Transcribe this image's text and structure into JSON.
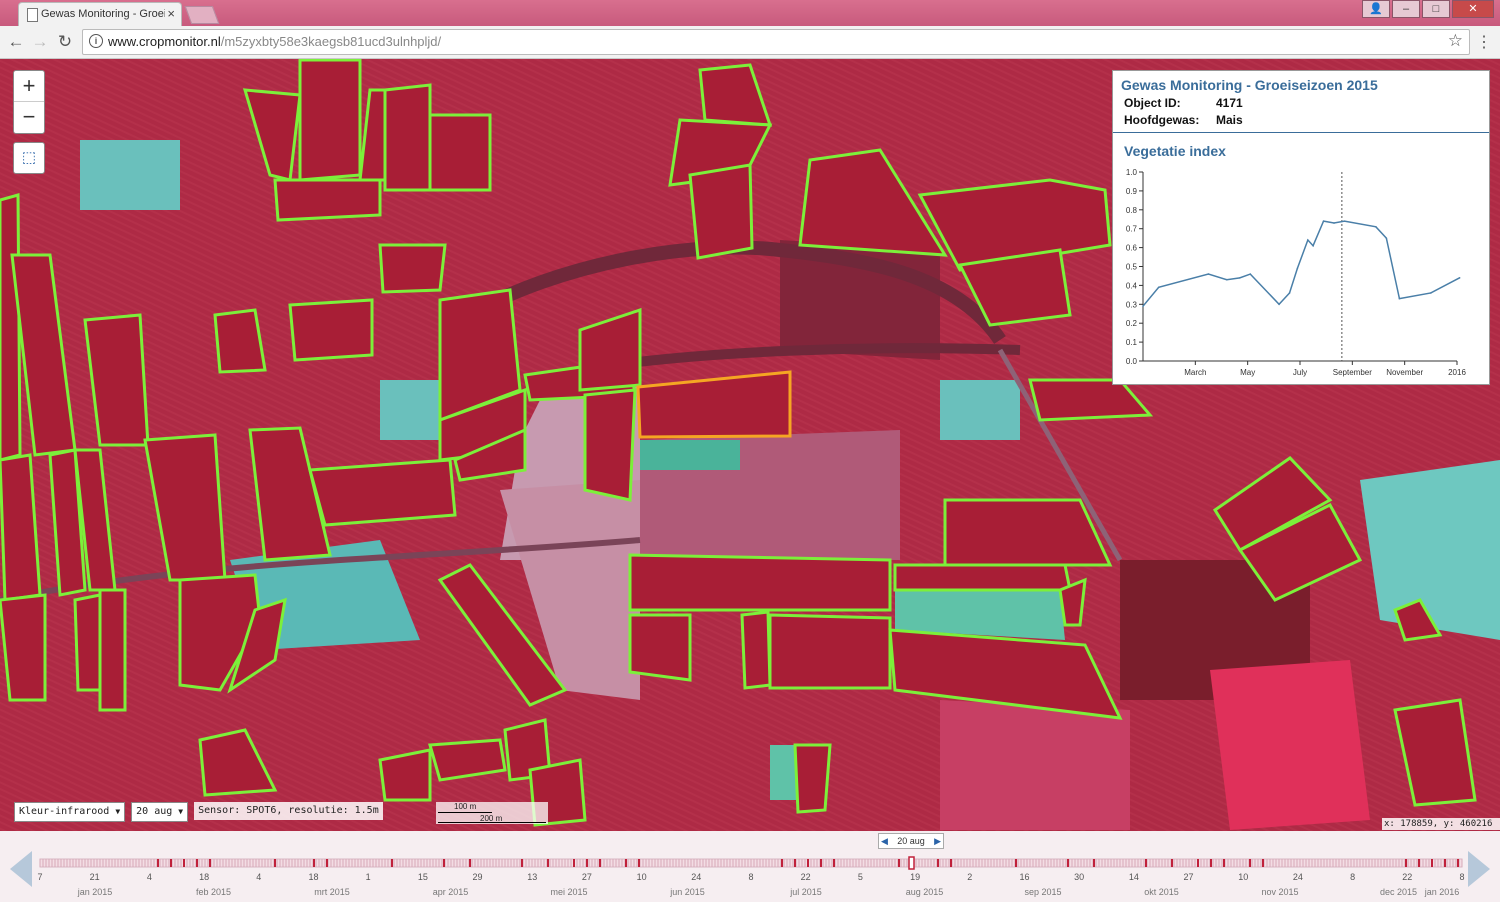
{
  "browser": {
    "tab_title": "Gewas Monitoring - Groeiseizoen 2015",
    "url_host": "www.cropmonitor.nl",
    "url_path": "/m5zyxbty58e3kaegsb81ucd3ulnhpljd/"
  },
  "map": {
    "zoom_in": "+",
    "zoom_out": "−",
    "layer_select": "Kleur-infrarood",
    "date_select": "20 aug",
    "sensor_text": "Sensor: SPOT6, resolutie: 1.5m",
    "scale_100": "100 m",
    "scale_200": "200 m",
    "coord_readout": "x: 178859, y: 460216"
  },
  "panel": {
    "title": "Gewas Monitoring - Groeiseizoen 2015",
    "object_id_label": "Object ID:",
    "object_id_value": "4171",
    "crop_label": "Hoofdgewas:",
    "crop_value": "Mais",
    "chart_title": "Vegetatie index"
  },
  "chart_data": {
    "type": "line",
    "title": "Vegetatie index",
    "xlabel": "",
    "ylabel": "",
    "ylim": [
      0,
      1.0
    ],
    "yticks": [
      "0.0",
      "0.1",
      "0.2",
      "0.3",
      "0.4",
      "0.5",
      "0.6",
      "0.7",
      "0.8",
      "0.9",
      "1.0"
    ],
    "xticks": [
      "March",
      "May",
      "July",
      "September",
      "November",
      "2016"
    ],
    "xtick_months": [
      2,
      4,
      6,
      8,
      10,
      12
    ],
    "xrange_months": [
      0,
      12
    ],
    "current_marker_month": 7.6,
    "series": [
      {
        "values": [
          {
            "x": 0.0,
            "y": 0.29
          },
          {
            "x": 0.6,
            "y": 0.39
          },
          {
            "x": 2.5,
            "y": 0.46
          },
          {
            "x": 3.2,
            "y": 0.43
          },
          {
            "x": 3.7,
            "y": 0.44
          },
          {
            "x": 4.1,
            "y": 0.46
          },
          {
            "x": 5.2,
            "y": 0.3
          },
          {
            "x": 5.6,
            "y": 0.36
          },
          {
            "x": 5.9,
            "y": 0.49
          },
          {
            "x": 6.3,
            "y": 0.64
          },
          {
            "x": 6.5,
            "y": 0.61
          },
          {
            "x": 6.9,
            "y": 0.74
          },
          {
            "x": 7.3,
            "y": 0.73
          },
          {
            "x": 7.7,
            "y": 0.74
          },
          {
            "x": 8.9,
            "y": 0.71
          },
          {
            "x": 9.3,
            "y": 0.65
          },
          {
            "x": 9.8,
            "y": 0.33
          },
          {
            "x": 11.0,
            "y": 0.36
          },
          {
            "x": 12.1,
            "y": 0.44
          }
        ]
      }
    ]
  },
  "timeline": {
    "current_date": "20 aug",
    "day_labels": [
      "7",
      "21",
      "4",
      "18",
      "4",
      "18",
      "1",
      "15",
      "29",
      "13",
      "27",
      "10",
      "24",
      "8",
      "22",
      "5",
      "19",
      "2",
      "16",
      "30",
      "14",
      "27",
      "10",
      "24",
      "8",
      "22",
      "8"
    ],
    "month_labels": [
      "jan 2015",
      "feb 2015",
      "mrt 2015",
      "apr 2015",
      "mei 2015",
      "jun 2015",
      "jul 2015",
      "aug 2015",
      "sep 2015",
      "okt 2015",
      "nov 2015",
      "dec 2015",
      "jan 2016"
    ]
  }
}
